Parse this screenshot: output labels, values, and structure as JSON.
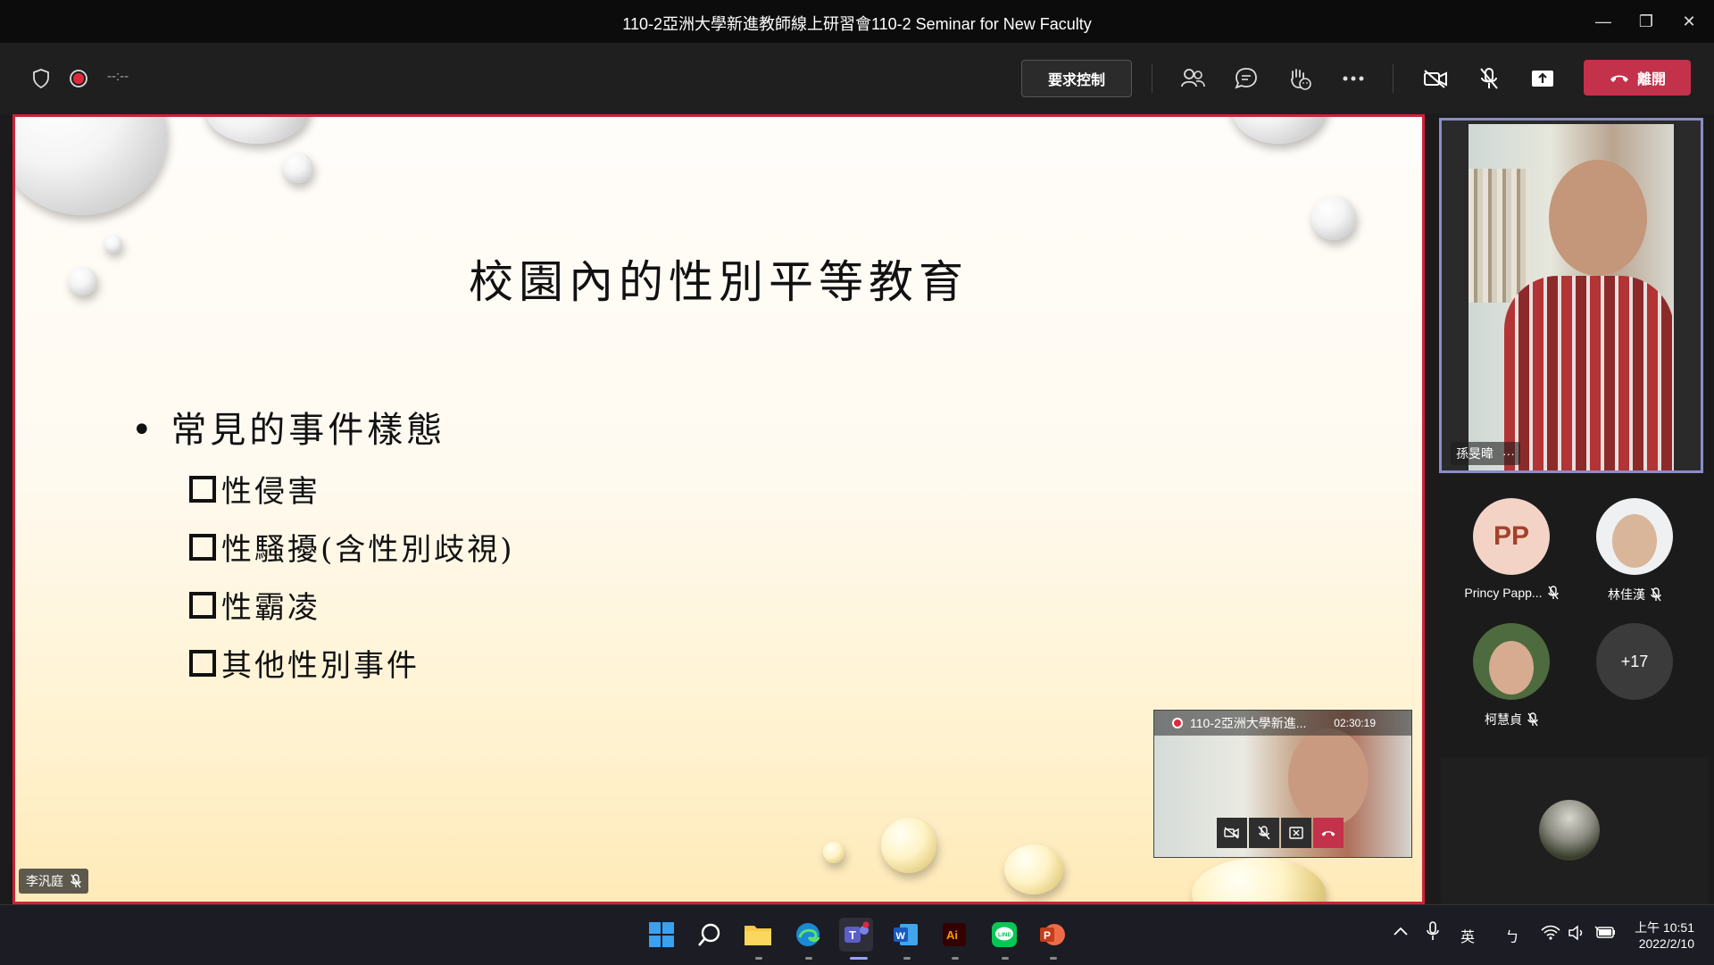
{
  "window": {
    "title": "110-2亞洲大學新進教師線上研習會110-2 Seminar for New Faculty",
    "minimize": "—",
    "maximize": "❐",
    "close": "✕"
  },
  "toolbar": {
    "timer": "--:--",
    "request_control": "要求控制",
    "leave": "離開"
  },
  "slide": {
    "title": "校園內的性別平等教育",
    "bullet": "常見的事件樣態",
    "items": [
      "性侵害",
      "性騷擾(含性別歧視)",
      "性霸凌",
      "其他性別事件"
    ],
    "speaker": "李汎庭"
  },
  "mini_window": {
    "title": "110-2亞洲大學新進...",
    "time": "02:30:19"
  },
  "participants": {
    "pinned_name": "孫旻暐",
    "pinned_more": "···",
    "p1_initials": "PP",
    "p1_name": "Princy Papp...",
    "p2_name": "林佳漢",
    "p3_name": "柯慧貞",
    "more_count": "+17"
  },
  "taskbar": {
    "ime_lang": "英",
    "ime_mode": "ㄅ",
    "time": "上午 10:51",
    "date": "2022/2/10"
  },
  "colors": {
    "leave_red": "#c4314b",
    "pinned_border": "#8b8cc7",
    "slide_border": "#d0203a",
    "avatar_pp_bg": "#f3d3c6",
    "avatar_pp_text": "#a2422b"
  }
}
